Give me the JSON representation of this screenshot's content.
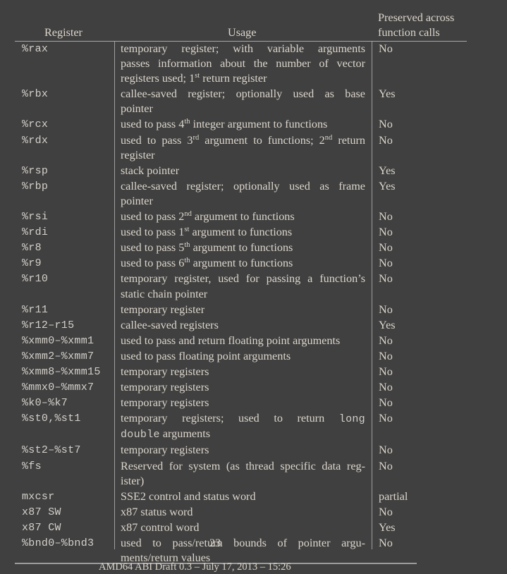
{
  "table": {
    "headers": {
      "register": "Register",
      "usage": "Usage",
      "preserved_line1": "Preserved across",
      "preserved_line2": "function calls"
    },
    "rows": [
      {
        "register": "%rax",
        "usage_lines": [
          "temporary register; with variable arguments",
          "passes information about the number of vector",
          "registers used; 1|st| return register"
        ],
        "preserved": "No"
      },
      {
        "register": "%rbx",
        "usage_lines": [
          "callee-saved register; optionally used as base",
          "pointer"
        ],
        "preserved": "Yes"
      },
      {
        "register": "%rcx",
        "usage_lines": [
          "used to pass 4|th| integer argument to functions"
        ],
        "preserved": "No"
      },
      {
        "register": "%rdx",
        "usage_lines": [
          "used to pass 3|rd| argument to functions; 2|nd| return",
          "register"
        ],
        "preserved": "No"
      },
      {
        "register": "%rsp",
        "usage_lines": [
          "stack pointer"
        ],
        "preserved": "Yes"
      },
      {
        "register": "%rbp",
        "usage_lines": [
          "callee-saved register; optionally used as frame",
          "pointer"
        ],
        "preserved": "Yes"
      },
      {
        "register": "%rsi",
        "usage_lines": [
          "used to pass 2|nd| argument to functions"
        ],
        "preserved": "No"
      },
      {
        "register": "%rdi",
        "usage_lines": [
          "used to pass 1|st| argument to functions"
        ],
        "preserved": "No"
      },
      {
        "register": "%r8",
        "usage_lines": [
          "used to pass 5|th| argument to functions"
        ],
        "preserved": "No"
      },
      {
        "register": "%r9",
        "usage_lines": [
          "used to pass 6|th| argument to functions"
        ],
        "preserved": "No"
      },
      {
        "register": "%r10",
        "usage_lines": [
          "temporary register, used for passing a function’s",
          "static chain pointer"
        ],
        "preserved": "No"
      },
      {
        "register": "%r11",
        "usage_lines": [
          "temporary register"
        ],
        "preserved": "No"
      },
      {
        "register": "%r12–r15",
        "usage_lines": [
          "callee-saved registers"
        ],
        "preserved": "Yes"
      },
      {
        "register": "%xmm0–%xmm1",
        "usage_lines": [
          "used to pass and return floating point arguments"
        ],
        "preserved": "No"
      },
      {
        "register": "%xmm2–%xmm7",
        "usage_lines": [
          "used to pass floating point arguments"
        ],
        "preserved": "No"
      },
      {
        "register": "%xmm8–%xmm15",
        "usage_lines": [
          "temporary registers"
        ],
        "preserved": "No"
      },
      {
        "register": "%mmx0–%mmx7",
        "usage_lines": [
          "temporary registers"
        ],
        "preserved": "No"
      },
      {
        "register": "%k0–%k7",
        "usage_lines": [
          "temporary registers"
        ],
        "preserved": "No"
      },
      {
        "register": "%st0,%st1",
        "usage_lines": [
          "temporary registers; used to return `long`",
          "`double` arguments"
        ],
        "preserved": "No"
      },
      {
        "register": "%st2–%st7",
        "usage_lines": [
          "temporary registers"
        ],
        "preserved": "No"
      },
      {
        "register": "%fs",
        "usage_lines": [
          "Reserved for system (as thread specific data reg-",
          "ister)"
        ],
        "preserved": "No"
      },
      {
        "register": "mxcsr",
        "usage_lines": [
          "SSE2 control and status word"
        ],
        "preserved": "partial"
      },
      {
        "register": "x87 SW",
        "usage_lines": [
          "x87 status word"
        ],
        "preserved": "No"
      },
      {
        "register": "x87 CW",
        "usage_lines": [
          "x87 control word"
        ],
        "preserved": "Yes"
      },
      {
        "register": "%bnd0–%bnd3",
        "usage_lines": [
          "used to pass/return bounds of pointer argu-",
          "ments/return values"
        ],
        "preserved": "No"
      }
    ]
  },
  "page_number": "23",
  "footer": "AMD64 ABI Draft 0.3 – July 17, 2013 – 15:26"
}
